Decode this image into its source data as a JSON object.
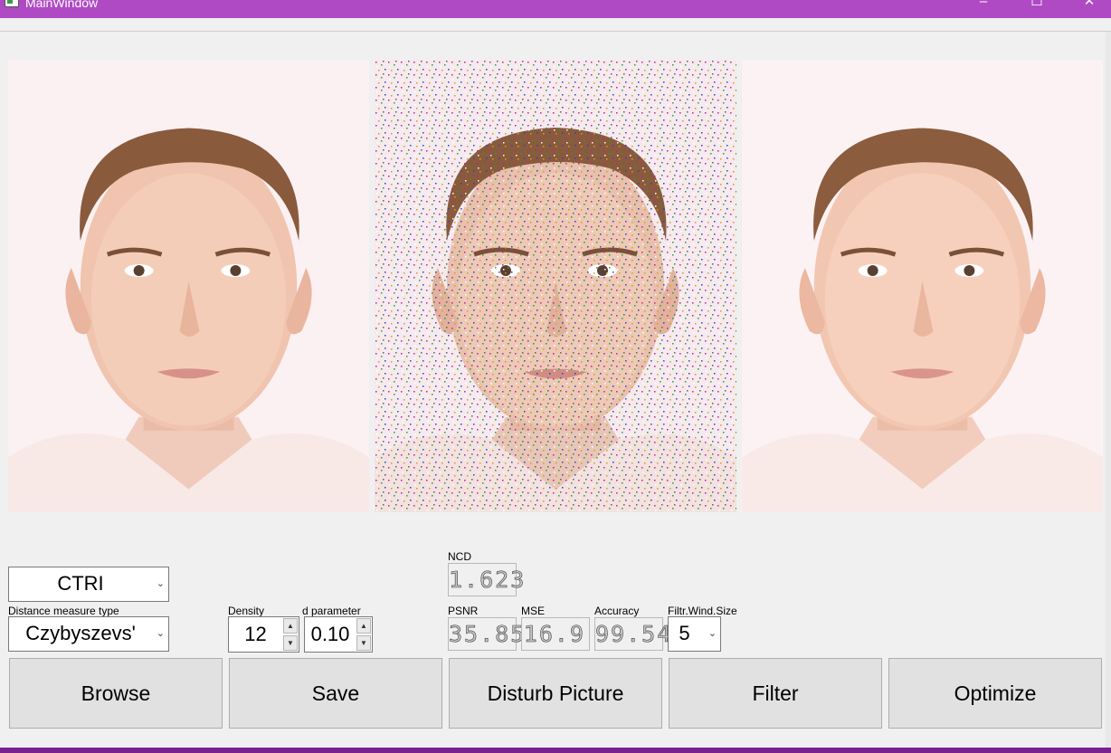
{
  "window": {
    "title": "MainWindow",
    "minimize": "–",
    "maximize": "☐",
    "close": "✕"
  },
  "images": [
    {
      "name": "original-image"
    },
    {
      "name": "disturbed-image"
    },
    {
      "name": "filtered-image"
    }
  ],
  "controls": {
    "metric_combo": "CTRI",
    "distance_label": "Distance measure type",
    "distance_combo": "Czybyszevs'",
    "density_label": "Density",
    "density_value": "12",
    "d_param_label": "d parameter",
    "d_param_value": "0.10",
    "ncd_label": "NCD",
    "ncd_value": "1.623",
    "psnr_label": "PSNR",
    "psnr_value": "35.85",
    "mse_label": "MSE",
    "mse_value": "16.9",
    "accuracy_label": "Accuracy",
    "accuracy_value": "99.54",
    "filter_size_label": "Filtr.Wind.Size",
    "filter_size_value": "5"
  },
  "buttons": {
    "browse": "Browse",
    "save": "Save",
    "disturb": "Disturb Picture",
    "filter": "Filter",
    "optimize": "Optimize"
  },
  "icons": {
    "combo_arrow": "chevron-down-icon",
    "spin_up": "spin-up-icon",
    "spin_down": "spin-down-icon"
  }
}
